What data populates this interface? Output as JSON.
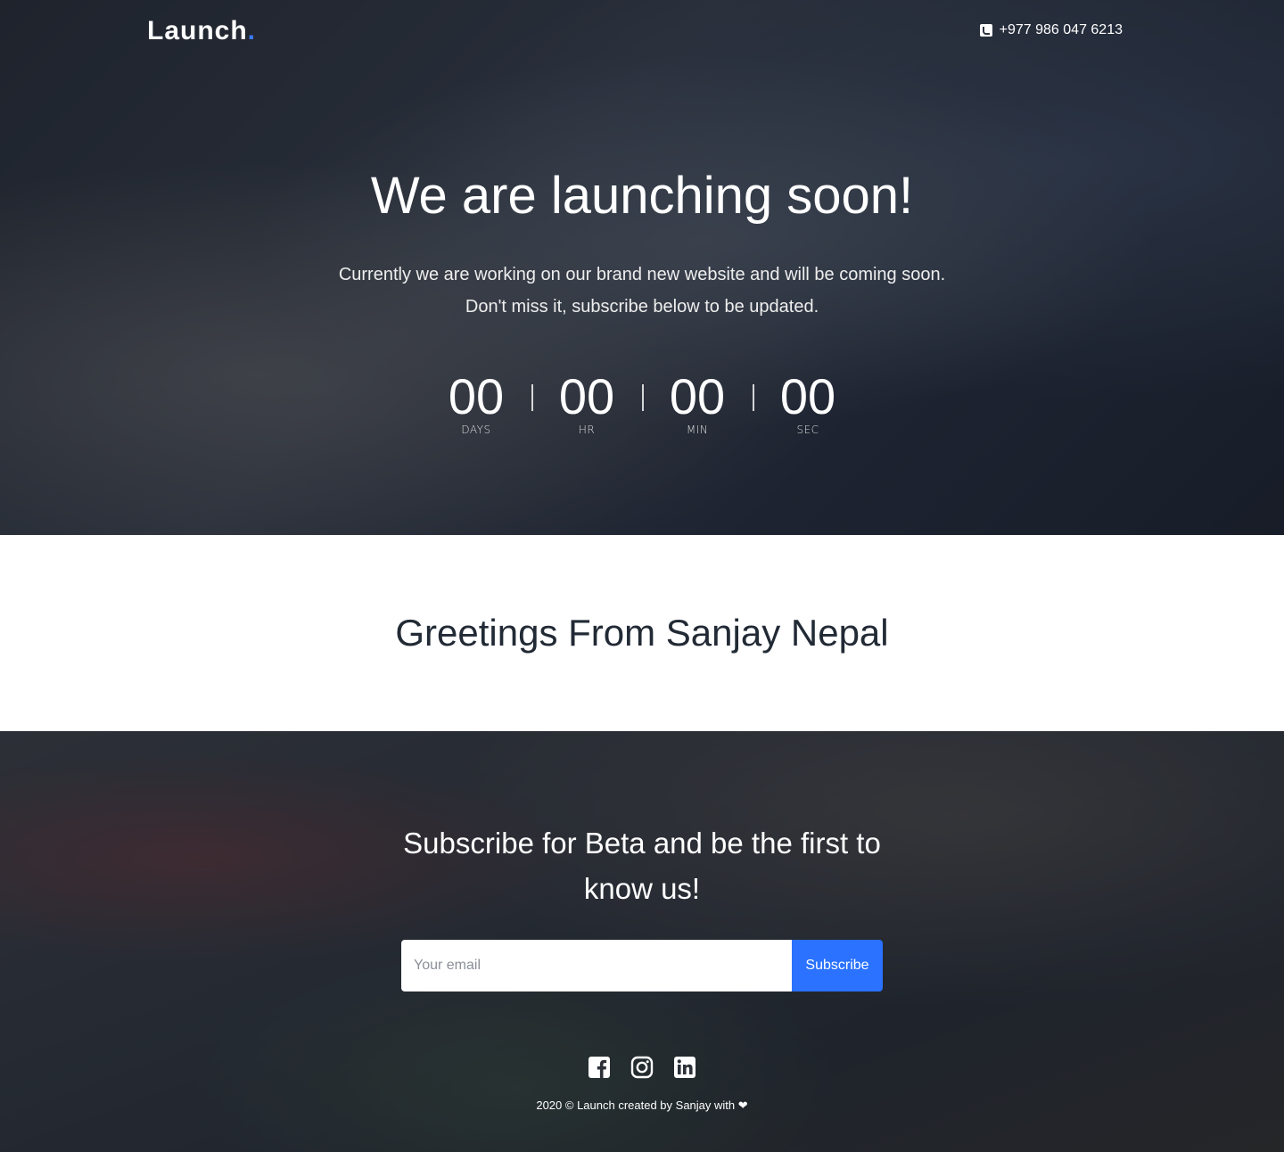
{
  "header": {
    "logo_text": "Launch",
    "logo_dot": ".",
    "phone": "+977 986 047 6213",
    "accent_color": "#3b7bff"
  },
  "hero": {
    "title": "We are launching soon!",
    "subtitle_line1": "Currently we are working on our brand new website and will be coming soon.",
    "subtitle_line2": "Don't miss it, subscribe below to be updated."
  },
  "countdown": [
    {
      "value": "00",
      "label": "DAYS"
    },
    {
      "value": "00",
      "label": "HR"
    },
    {
      "value": "00",
      "label": "MIN"
    },
    {
      "value": "00",
      "label": "SEC"
    }
  ],
  "greeting": {
    "title": "Greetings From Sanjay Nepal"
  },
  "subscribe": {
    "title": "Subscribe for Beta and be the first to know us!",
    "email_placeholder": "Your email",
    "button_label": "Subscribe",
    "button_color": "#2a72ff"
  },
  "socials": [
    {
      "icon": "facebook-icon"
    },
    {
      "icon": "instagram-icon"
    },
    {
      "icon": "linkedin-icon"
    }
  ],
  "footer": {
    "text": "2020 © Launch created by Sanjay with ❤"
  }
}
